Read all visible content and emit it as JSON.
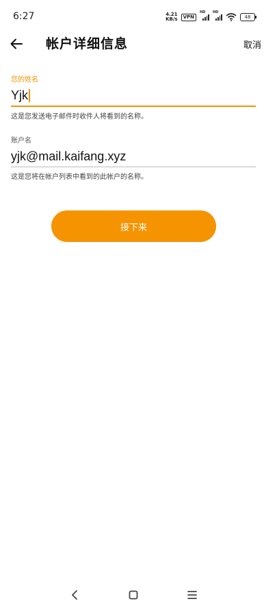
{
  "status_bar": {
    "time": "6:27",
    "net_speed_value": "4.21",
    "net_speed_unit": "KB/s",
    "vpn": "VPN",
    "signal1_hd": "HD",
    "signal2_hd": "HD",
    "battery": "48"
  },
  "header": {
    "title": "帐户详细信息",
    "cancel_label": "取消",
    "back_icon": "arrow-left-icon"
  },
  "form": {
    "name_field": {
      "label": "您的姓名",
      "value": "Yjk",
      "hint": "这是您发送电子邮件时收件人将看到的名称。"
    },
    "account_field": {
      "label": "账户名",
      "value": "yjk@mail.kaifang.xyz",
      "hint": "这是您将在帐户列表中看到的此帐户的名称。"
    }
  },
  "next_button": {
    "label": "接下来"
  },
  "nav_bar": {
    "back_icon": "chevron-left-icon",
    "home_icon": "square-home-icon",
    "menu_icon": "hamburger-menu-icon"
  },
  "colors": {
    "accent": "#f69300",
    "background": "#ffffff",
    "text": "#111111"
  }
}
